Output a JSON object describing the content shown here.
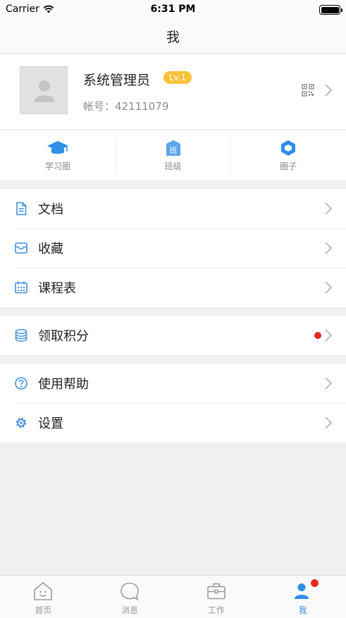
{
  "status_bar": {
    "carrier": "Carrier",
    "time": "6:31 PM"
  },
  "nav": {
    "title": "我"
  },
  "profile": {
    "name": "系统管理员",
    "level": "Lv.1",
    "account_label": "帐号：",
    "account_number": "42111079"
  },
  "shortcuts": [
    {
      "label": "学习圈",
      "icon": "graduation-cap-icon"
    },
    {
      "label": "班级",
      "icon": "class-icon",
      "icon_text": "班"
    },
    {
      "label": "圈子",
      "icon": "hexagon-icon"
    }
  ],
  "menu_groups": [
    [
      {
        "label": "文档",
        "icon": "document-icon"
      },
      {
        "label": "收藏",
        "icon": "inbox-icon"
      },
      {
        "label": "课程表",
        "icon": "calendar-icon"
      }
    ],
    [
      {
        "label": "领取积分",
        "icon": "coins-icon",
        "badge": true
      }
    ],
    [
      {
        "label": "使用帮助",
        "icon": "help-icon"
      },
      {
        "label": "设置",
        "icon": "gear-icon"
      }
    ]
  ],
  "tab_bar": {
    "items": [
      {
        "label": "首页",
        "icon": "home-icon"
      },
      {
        "label": "消息",
        "icon": "message-icon"
      },
      {
        "label": "工作",
        "icon": "briefcase-icon"
      },
      {
        "label": "我",
        "icon": "user-icon",
        "active": true,
        "badge": true
      }
    ]
  },
  "colors": {
    "accent": "#2d8fe8",
    "badge_red": "#e52b22",
    "level_badge": "#f9c13a"
  }
}
